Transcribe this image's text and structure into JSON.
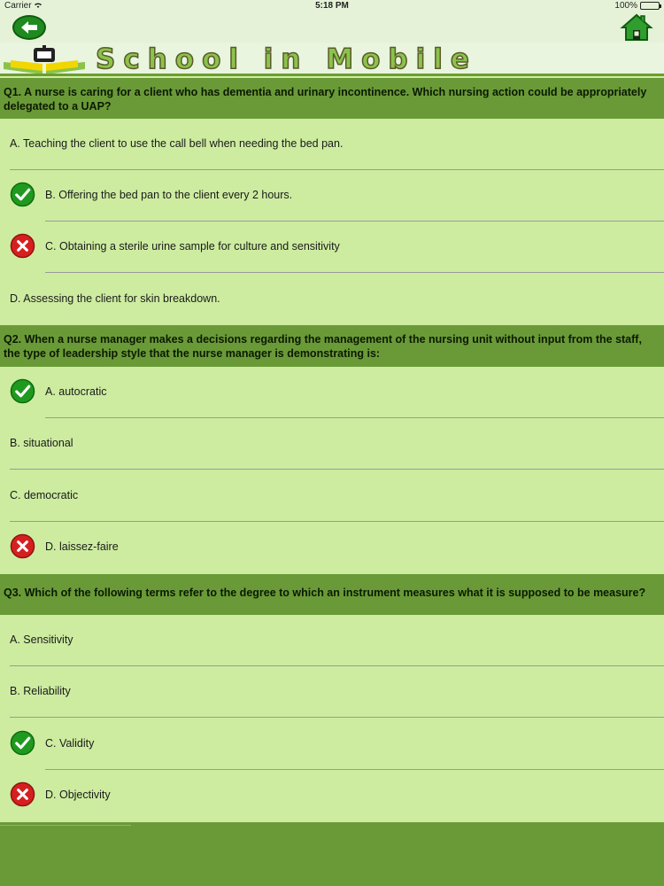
{
  "status_bar": {
    "carrier": "Carrier",
    "wifi_icon": "wifi-icon",
    "time": "5:18 PM",
    "battery": "100%"
  },
  "nav": {
    "back_icon": "back-arrow-icon",
    "home_icon": "home-icon"
  },
  "banner": {
    "title": "School in Mobile",
    "logo_icon": "book-logo-icon"
  },
  "colors": {
    "question_bg": "#6a9a38",
    "page_bg": "#cdeca0",
    "correct": "#1f9a1f",
    "wrong": "#d62020"
  },
  "questions": [
    {
      "text": "Q1. A nurse is caring for a client who has dementia and urinary incontinence. Which nursing action could be appropriately delegated to a UAP?",
      "options": [
        {
          "text": "A. Teaching the client to use the call bell when needing the bed pan.",
          "mark": "none"
        },
        {
          "text": "B. Offering the bed pan to the client every 2 hours.",
          "mark": "correct"
        },
        {
          "text": "C. Obtaining a sterile urine sample for culture and sensitivity",
          "mark": "wrong"
        },
        {
          "text": "D. Assessing the client for skin breakdown.",
          "mark": "none"
        }
      ]
    },
    {
      "text": "Q2. When a nurse manager makes a decisions regarding the management of the nursing unit without input from the staff, the type of leadership style that the nurse manager is demonstrating is:",
      "options": [
        {
          "text": "A. autocratic",
          "mark": "correct"
        },
        {
          "text": "B. situational",
          "mark": "none"
        },
        {
          "text": "C. democratic",
          "mark": "none"
        },
        {
          "text": "D.  laissez-faire",
          "mark": "wrong"
        }
      ]
    },
    {
      "text": "Q3.  Which of the following terms refer to the degree to which an instrument measures what it is supposed to be measure?",
      "options": [
        {
          "text": "A. Sensitivity",
          "mark": "none"
        },
        {
          "text": "B.  Reliability",
          "mark": "none"
        },
        {
          "text": "C. Validity",
          "mark": "correct"
        },
        {
          "text": "D. Objectivity",
          "mark": "wrong"
        }
      ]
    }
  ]
}
